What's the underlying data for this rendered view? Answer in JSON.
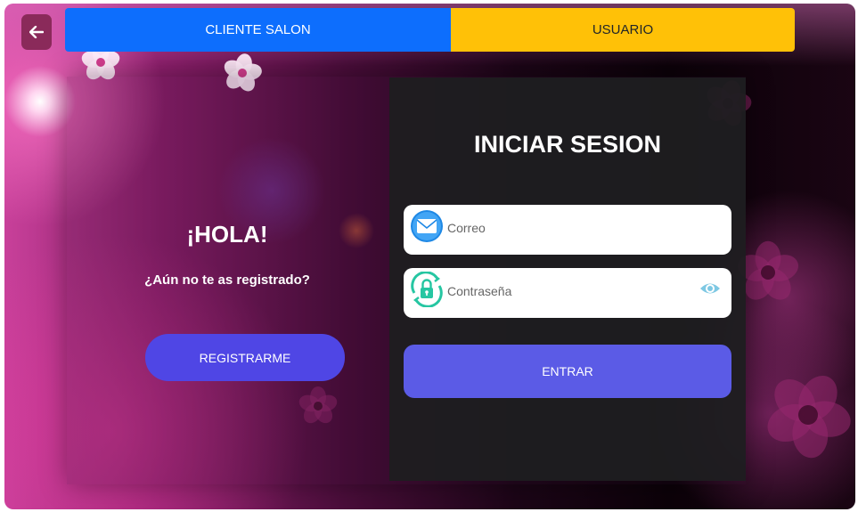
{
  "header": {
    "back_icon": "arrow-left-icon",
    "tabs": [
      {
        "label": "CLIENTE SALON",
        "color": "#0d6efd",
        "active": true
      },
      {
        "label": "USUARIO",
        "color": "#ffc107",
        "active": false
      }
    ]
  },
  "welcome": {
    "title": "¡HOLA!",
    "prompt": "¿Aún no te as registrado?",
    "register_button": "REGISTRARME",
    "register_color": "#4f46e5"
  },
  "login": {
    "title": "INICIAR SESION",
    "email_placeholder": "Correo",
    "email_icon": "envelope-icon",
    "password_placeholder": "Contraseña",
    "password_icon": "lock-icon",
    "toggle_icon": "eye-icon",
    "submit_button": "ENTRAR",
    "submit_color": "#5b5be6"
  },
  "background": {
    "theme": "pink-floral",
    "accent": "#c8409a"
  }
}
